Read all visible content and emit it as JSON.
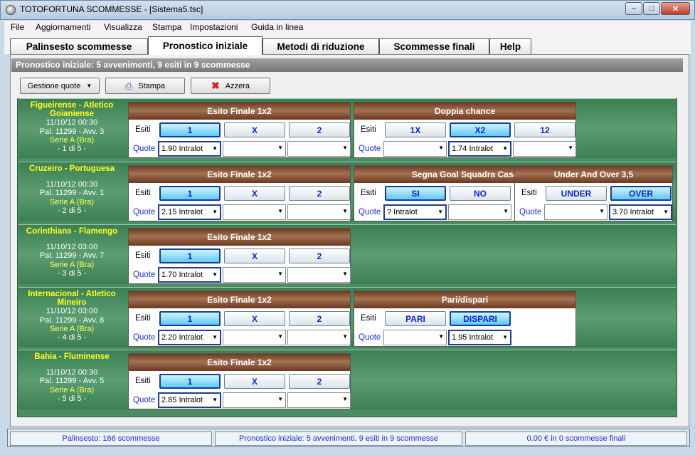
{
  "window": {
    "title": "TOTOFORTUNA SCOMMESSE - [Sistema5.tsc]"
  },
  "menu": [
    "File",
    "Aggiornamenti",
    "Visualizza",
    "Stampa",
    "Impostazioni",
    "Guida in linea"
  ],
  "tabs": [
    "Palinsesto scommesse",
    "Pronostico iniziale",
    "Metodi di riduzione",
    "Scommesse finali",
    "Help"
  ],
  "panel_header": "Pronostico iniziale: 5 avvenimenti, 9 esiti in 9 scommesse",
  "toolbar": {
    "gestione": "Gestione quote",
    "stampa": "Stampa",
    "azzera": "Azzera"
  },
  "labels": {
    "esiti": "Esiti",
    "quote": "Quote"
  },
  "matches": [
    {
      "name": "Figueirense - Atletico Goianiense",
      "datetime": "11/10/12 00:30",
      "pal": "Pal. 11299 - Avv. 3",
      "league": "Serie A (Bra)",
      "index": "- 1 di 5 -",
      "markets": [
        {
          "title": "Esito Finale 1x2",
          "options": [
            "1",
            "X",
            "2"
          ],
          "quotes": [
            "1.90 Intralot",
            "",
            ""
          ]
        },
        {
          "title": "Doppia chance",
          "options": [
            "1X",
            "X2",
            "12"
          ],
          "quotes": [
            "",
            "1.74 Intralot",
            ""
          ]
        }
      ]
    },
    {
      "name": "Cruzeiro - Portuguesa",
      "datetime": "11/10/12 00:30",
      "pal": "Pal. 11299 - Avv. 1",
      "league": "Serie A (Bra)",
      "index": "- 2 di 5 -",
      "markets": [
        {
          "title": "Esito Finale 1x2",
          "options": [
            "1",
            "X",
            "2"
          ],
          "quotes": [
            "2.15 Intralot",
            "",
            ""
          ]
        },
        {
          "title": "Segna Goal Squadra Casa",
          "options": [
            "SI",
            "NO"
          ],
          "quotes": [
            "? Intralot",
            ""
          ]
        },
        {
          "title": "Under And Over 3,5",
          "options": [
            "UNDER",
            "OVER"
          ],
          "quotes": [
            "",
            "3.70 Intralot"
          ]
        }
      ]
    },
    {
      "name": "Corinthians - Flamengo",
      "datetime": "11/10/12 03:00",
      "pal": "Pal. 11299 - Avv. 7",
      "league": "Serie A (Bra)",
      "index": "- 3 di 5 -",
      "markets": [
        {
          "title": "Esito Finale 1x2",
          "options": [
            "1",
            "X",
            "2"
          ],
          "quotes": [
            "1.70 Intralot",
            "",
            ""
          ]
        }
      ]
    },
    {
      "name": "Internacional - Atletico Mineiro",
      "datetime": "11/10/12 03:00",
      "pal": "Pal. 11299 - Avv. 8",
      "league": "Serie A (Bra)",
      "index": "- 4 di 5 -",
      "markets": [
        {
          "title": "Esito Finale 1x2",
          "options": [
            "1",
            "X",
            "2"
          ],
          "quotes": [
            "2.20 Intralot",
            "",
            ""
          ]
        },
        {
          "title": "Pari/dispari",
          "options": [
            "PARI",
            "DISPARI"
          ],
          "quotes": [
            "",
            "1.95 Intralot"
          ]
        }
      ]
    },
    {
      "name": "Bahia - Fluminense",
      "datetime": "11/10/12 00:30",
      "pal": "Pal. 11299 - Avv. 5",
      "league": "Serie A (Bra)",
      "index": "- 5 di 5 -",
      "markets": [
        {
          "title": "Esito Finale 1x2",
          "options": [
            "1",
            "X",
            "2"
          ],
          "quotes": [
            "2.85 Intralot",
            "",
            ""
          ]
        }
      ]
    }
  ],
  "status": [
    "Palinsesto: 166 scommesse",
    "Pronostico iniziale: 5 avvenimenti, 9 esiti in 9 scommesse",
    "0.00 € in 0 scommesse finali"
  ]
}
